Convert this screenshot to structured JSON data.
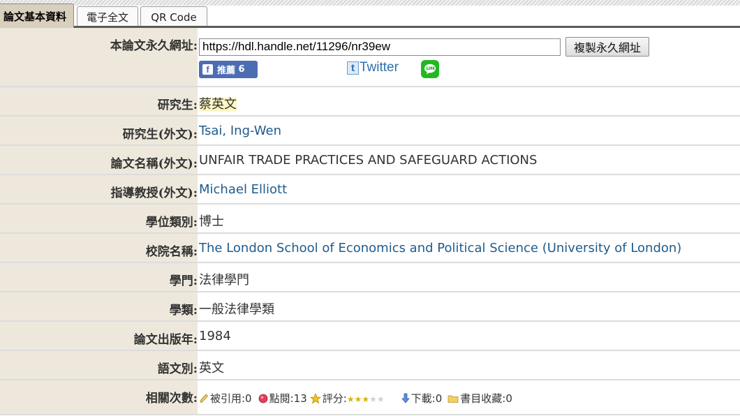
{
  "tabs": [
    {
      "label": "論文基本資料",
      "active": true
    },
    {
      "label": "電子全文",
      "active": false
    },
    {
      "label": "QR Code",
      "active": false
    }
  ],
  "permalink": {
    "label": "本論文永久網址:",
    "url": "https://hdl.handle.net/11296/nr39ew",
    "copy_button": "複製永久網址",
    "facebook_label": "推薦",
    "facebook_count": "6",
    "twitter_label": "Twitter"
  },
  "rows": [
    {
      "label": "研究生:",
      "value": "蔡英文"
    },
    {
      "label": "研究生(外文):",
      "value": "Tsai, Ing-Wen"
    },
    {
      "label": "論文名稱(外文):",
      "value": "UNFAIR TRADE PRACTICES AND SAFEGUARD ACTIONS"
    },
    {
      "label": "指導教授(外文):",
      "value": "Michael Elliott"
    },
    {
      "label": "學位類別:",
      "value": "博士"
    },
    {
      "label": "校院名稱:",
      "value": "The London School of Economics and Political Science (University of London)"
    },
    {
      "label": "學門:",
      "value": "法律學門"
    },
    {
      "label": "學類:",
      "value": "一般法律學類"
    },
    {
      "label": "論文出版年:",
      "value": "1984"
    },
    {
      "label": "語文別:",
      "value": "英文"
    }
  ],
  "stats": {
    "label": "相關次數:",
    "cited": "被引用:0",
    "views": "點閱:13",
    "rating_label": "評分:",
    "rating": 3,
    "rating_max": 5,
    "downloads": "下載:0",
    "bookmarks": "書目收藏:0"
  },
  "colors": {
    "label_bg": "#eee8dc",
    "active_tab_bg": "#d9cfbd",
    "link": "#1f5b8c",
    "facebook": "#4d6db3",
    "line": "#22b823",
    "name_highlight": "#fff7c4"
  }
}
